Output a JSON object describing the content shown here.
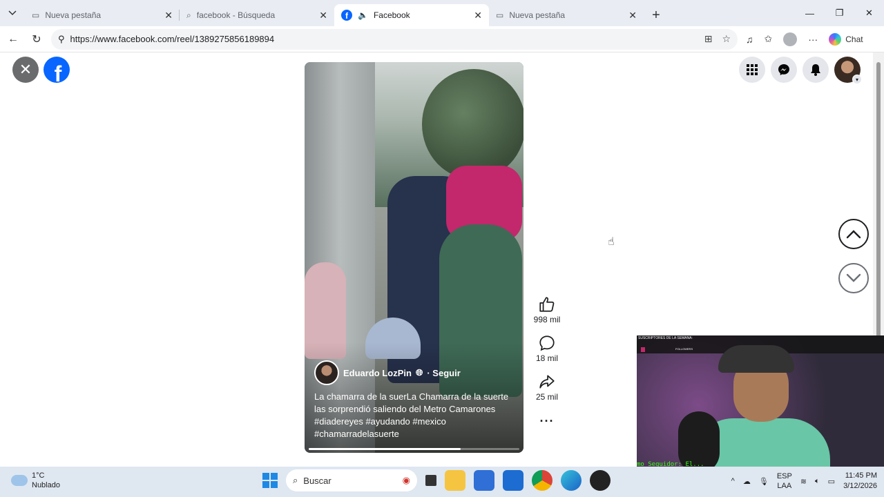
{
  "browser": {
    "tabs": [
      {
        "label": "Nueva pestaña",
        "icon": "page-icon"
      },
      {
        "label": "facebook - Búsqueda",
        "icon": "search-icon"
      },
      {
        "label": "Facebook",
        "icon": "facebook-icon",
        "active": true,
        "audio": true
      },
      {
        "label": "Nueva pestaña",
        "icon": "page-icon"
      }
    ],
    "url": "https://www.facebook.com/reel/1389275856189894",
    "chat_label": "Chat"
  },
  "reel": {
    "author": "Eduardo LozPin",
    "follow_label": "· Seguir",
    "caption": "La chamarra de la suerLa Chamarra de la suerte las sorprendió saliendo del Metro Camarones #diadereyes  #ayudando #mexico #chamarradelasuerte",
    "progress": 0.72,
    "likes": "998 mil",
    "comments": "18 mil",
    "shares": "25 mil",
    "more": "···"
  },
  "webcam": {
    "title": "SUSCRIPTORES DE LA SEMANA:",
    "chip": "",
    "label": "FOLLOWERS",
    "ticker": "mo Seguidor: El..."
  },
  "taskbar": {
    "temp": "1°C",
    "condition": "Nublado",
    "search_placeholder": "Buscar",
    "lang_top": "ESP",
    "lang_bottom": "LAA",
    "time": "11:45 PM",
    "date": "3/12/2026"
  },
  "colors": {
    "facebook_blue": "#0866ff",
    "reel_pink": "#c2286b"
  }
}
